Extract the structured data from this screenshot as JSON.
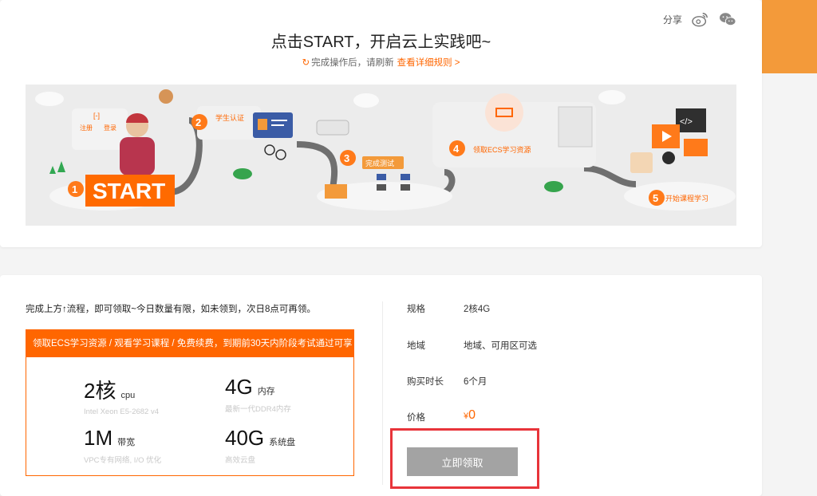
{
  "header": {
    "title": "点击START，开启云上实践吧~",
    "refresh_note": "完成操作后，请刷新",
    "rules_link": "查看详细规则 >",
    "share_label": "分享"
  },
  "banner": {
    "steps": [
      {
        "number": "1",
        "label": "START"
      },
      {
        "number": "2",
        "label": "学生认证"
      },
      {
        "number": "3",
        "label": "完成测试"
      },
      {
        "number": "4",
        "label": "领取ECS学习资源"
      },
      {
        "number": "5",
        "label": "开始课程学习"
      }
    ],
    "register": "注册",
    "login": "登录",
    "brand_icon": "[-]"
  },
  "offer": {
    "intro": "完成上方↑流程，即可领取~今日数量有限，如未领到，次日8点可再领。",
    "box_header": "领取ECS学习资源 / 观看学习课程 / 免费续费，到期前30天内阶段考试通过可享",
    "specs": [
      {
        "value": "2核",
        "unit": "cpu",
        "desc": "Intel Xeon E5-2682 v4"
      },
      {
        "value": "4G",
        "unit": "内存",
        "desc": "最新一代DDR4内存"
      },
      {
        "value": "1M",
        "unit": "带宽",
        "desc": "VPC专有网络, I/O 优化"
      },
      {
        "value": "40G",
        "unit": "系统盘",
        "desc": "高效云盘"
      }
    ]
  },
  "details": {
    "spec_label": "规格",
    "spec_value": "2核4G",
    "region_label": "地域",
    "region_value": "地域、可用区可选",
    "duration_label": "购买时长",
    "duration_value": "6个月",
    "price_label": "价格",
    "price_symbol": "¥",
    "price_value": "0"
  },
  "claim_button": "立即领取",
  "colors": {
    "accent": "#ff6600",
    "highlight_border": "#e8343a",
    "button_bg": "#a3a3a3"
  }
}
